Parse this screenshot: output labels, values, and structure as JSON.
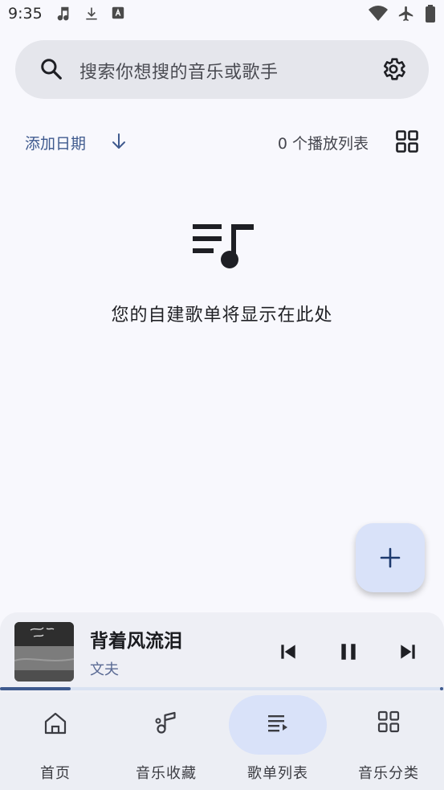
{
  "status_bar": {
    "time": "9:35",
    "left_icons": [
      "music-note-icon",
      "download-icon",
      "text-a-icon"
    ],
    "right_icons": [
      "wifi-icon",
      "airplane-icon",
      "battery-icon"
    ]
  },
  "search": {
    "placeholder": "搜索你想搜的音乐或歌手",
    "icon": "search-icon",
    "settings_icon": "gear-icon"
  },
  "toolbar": {
    "sort_label": "添加日期",
    "sort_direction_icon": "arrow-down-icon",
    "playlist_count": "0 个播放列表",
    "view_toggle_icon": "grid-view-icon"
  },
  "empty_state": {
    "icon": "playlist-music-icon",
    "message": "您的自建歌单将显示在此处"
  },
  "fab": {
    "icon": "plus-icon"
  },
  "now_playing": {
    "title": "背着风流泪",
    "artist": "文夫",
    "progress": 0.16,
    "controls": [
      "skip-previous-icon",
      "pause-icon",
      "skip-next-icon"
    ]
  },
  "bottom_nav": {
    "items": [
      {
        "label": "首页",
        "icon": "home-icon",
        "active": false
      },
      {
        "label": "音乐收藏",
        "icon": "music-notes-icon",
        "active": false
      },
      {
        "label": "歌单列表",
        "icon": "playlist-icon",
        "active": true
      },
      {
        "label": "音乐分类",
        "icon": "category-grid-icon",
        "active": false
      }
    ]
  },
  "colors": {
    "accent": "#3f5a8e",
    "background": "#f8f8fd",
    "search_bg": "#e5e6ec",
    "fab_bg": "#d9e2f9",
    "nav_active_pill": "#d9e2f9"
  }
}
